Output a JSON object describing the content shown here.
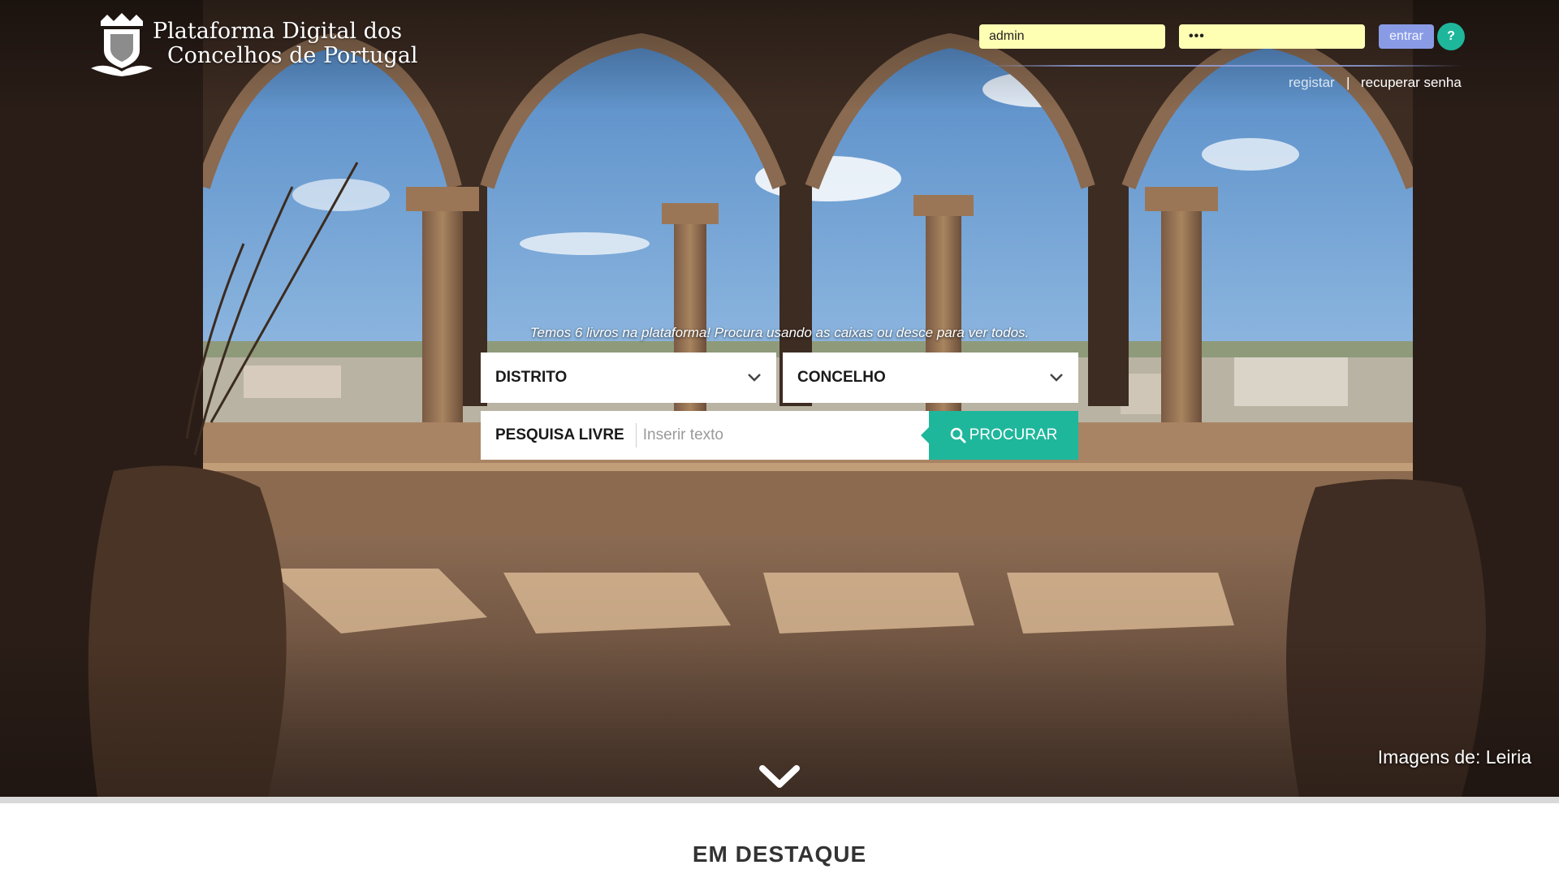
{
  "header": {
    "logo": {
      "line1": "Plataforma Digital dos",
      "line2": "Concelhos de Portugal",
      "icon": "crown-shield-icon"
    },
    "login": {
      "username_value": "admin",
      "password_value": "•••",
      "submit_label": "entrar",
      "help_label": "?",
      "register_link": "registar",
      "separator": "|",
      "recover_link": "recuperar senha"
    }
  },
  "search": {
    "caption": "Temos 6 livros na plataforma! Procura usando as caixas ou desce para ver todos.",
    "distrito_label": "DISTRITO",
    "concelho_label": "CONCELHO",
    "free_label": "PESQUISA LIVRE",
    "free_placeholder": "Inserir texto",
    "submit_label": "PROCURAR",
    "submit_icon": "search-icon"
  },
  "hero": {
    "image_credit": "Imagens de: Leiria",
    "scroll_icon": "chevron-down-icon"
  },
  "featured": {
    "title": "EM DESTAQUE"
  },
  "colors": {
    "accent": "#1fb79c",
    "login_field": "#ffffb4",
    "login_button": "#8a9be6"
  }
}
